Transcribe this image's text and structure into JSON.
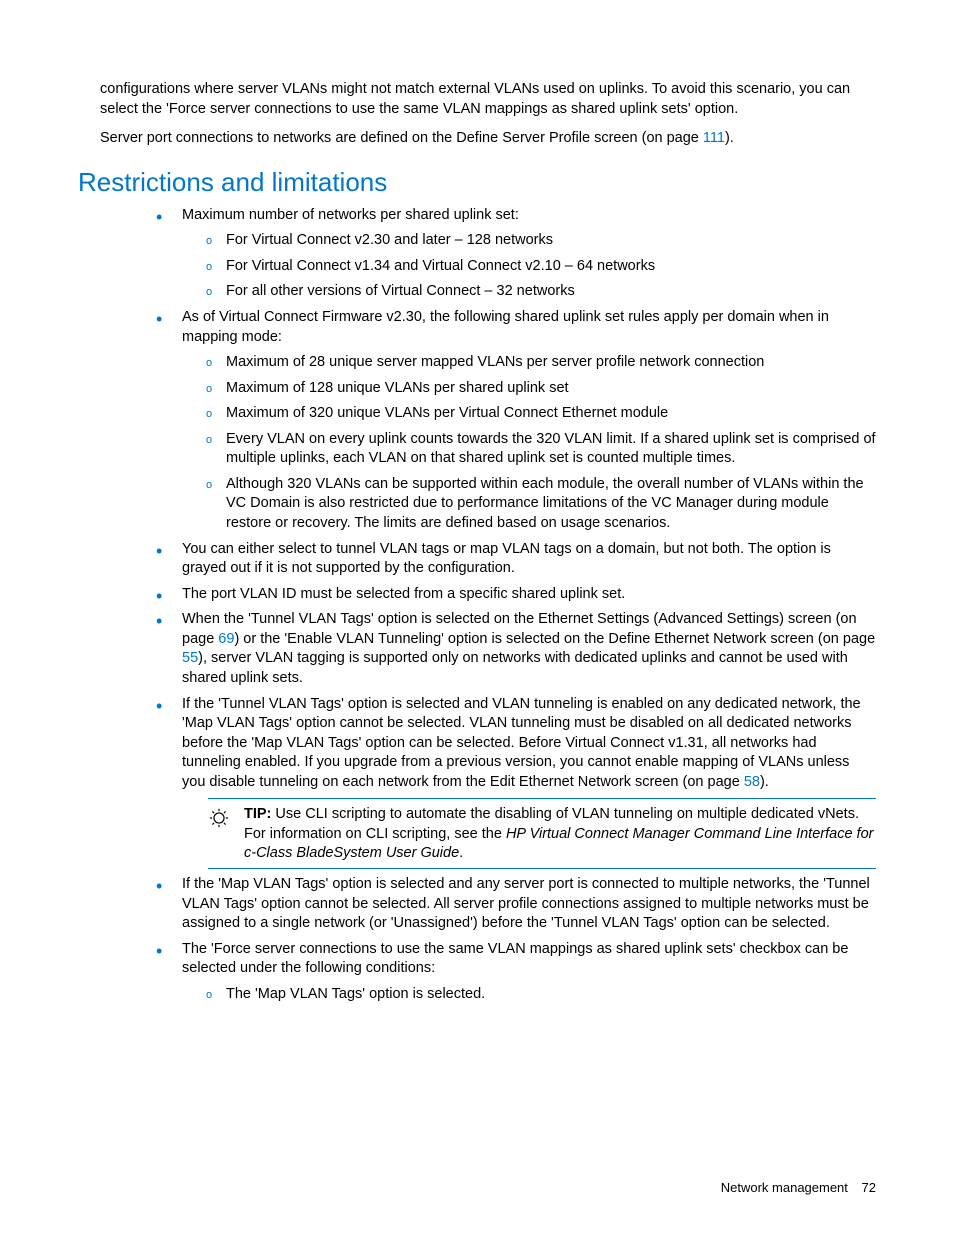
{
  "intro": {
    "p1": "configurations where server VLANs might not match external VLANs used on uplinks. To avoid this scenario, you can select the 'Force server connections to use the same VLAN mappings as shared uplink sets' option.",
    "p2_prefix": "Server port connections to networks are defined on the Define Server Profile screen (on page ",
    "p2_link": "111",
    "p2_suffix": ")."
  },
  "heading": "Restrictions and limitations",
  "list": {
    "item1": "Maximum number of networks per shared uplink set:",
    "item1_sub": [
      "For Virtual Connect v2.30 and later – 128 networks",
      "For Virtual Connect v1.34 and Virtual Connect v2.10 – 64 networks",
      "For all other versions of Virtual Connect – 32 networks"
    ],
    "item2": "As of Virtual Connect Firmware v2.30, the following shared uplink set rules apply per domain when in mapping mode:",
    "item2_sub": [
      "Maximum of 28 unique server mapped VLANs per server profile network connection",
      "Maximum of 128 unique VLANs per shared uplink set",
      "Maximum of 320 unique VLANs per Virtual Connect Ethernet module",
      "Every VLAN on every uplink counts towards the 320 VLAN limit. If a shared uplink set is comprised of multiple uplinks, each VLAN on that shared uplink set is counted multiple times.",
      "Although 320 VLANs can be supported within each module, the overall number of VLANs within the VC Domain is also restricted due to performance limitations of the VC Manager during module restore or recovery. The limits are defined based on usage scenarios."
    ],
    "item3": "You can either select to tunnel VLAN tags or map VLAN tags on a domain, but not both. The option is grayed out if it is not supported by the configuration.",
    "item4": "The port VLAN ID must be selected from a specific shared uplink set.",
    "item5_a": "When the 'Tunnel VLAN Tags' option is selected on the Ethernet Settings (Advanced Settings) screen (on page ",
    "item5_link1": "69",
    "item5_b": ") or the 'Enable VLAN Tunneling' option is selected on the Define Ethernet Network screen (on page ",
    "item5_link2": "55",
    "item5_c": "), server VLAN tagging is supported only on networks with dedicated uplinks and cannot be used with shared uplink sets.",
    "item6_a": "If the 'Tunnel VLAN Tags' option is selected and VLAN tunneling is enabled on any dedicated network, the 'Map VLAN Tags' option cannot be selected. VLAN tunneling must be disabled on all dedicated networks before the 'Map VLAN Tags' option can be selected. Before Virtual Connect v1.31, all networks had tunneling enabled. If you upgrade from a previous version, you cannot enable mapping of VLANs unless you disable tunneling on each network from the Edit Ethernet Network screen (on page ",
    "item6_link": "58",
    "item6_b": ").",
    "item7": "If the 'Map VLAN Tags' option is selected and any server port is connected to multiple networks, the 'Tunnel VLAN Tags' option cannot be selected. All server profile connections assigned to multiple networks must be assigned to a single network (or 'Unassigned') before the 'Tunnel VLAN Tags' option can be selected.",
    "item8": "The 'Force server connections to use the same VLAN mappings as shared uplink sets' checkbox can be selected under the following conditions:",
    "item8_sub": [
      "The 'Map VLAN Tags' option is selected."
    ]
  },
  "tip": {
    "label": "TIP:",
    "body_a": "   Use CLI scripting to automate the disabling of VLAN tunneling on multiple dedicated vNets. For information on CLI scripting, see the ",
    "body_i": "HP Virtual Connect Manager Command Line Interface for c-Class BladeSystem User Guide",
    "body_b": "."
  },
  "footer": {
    "section": "Network management",
    "page": "72"
  }
}
